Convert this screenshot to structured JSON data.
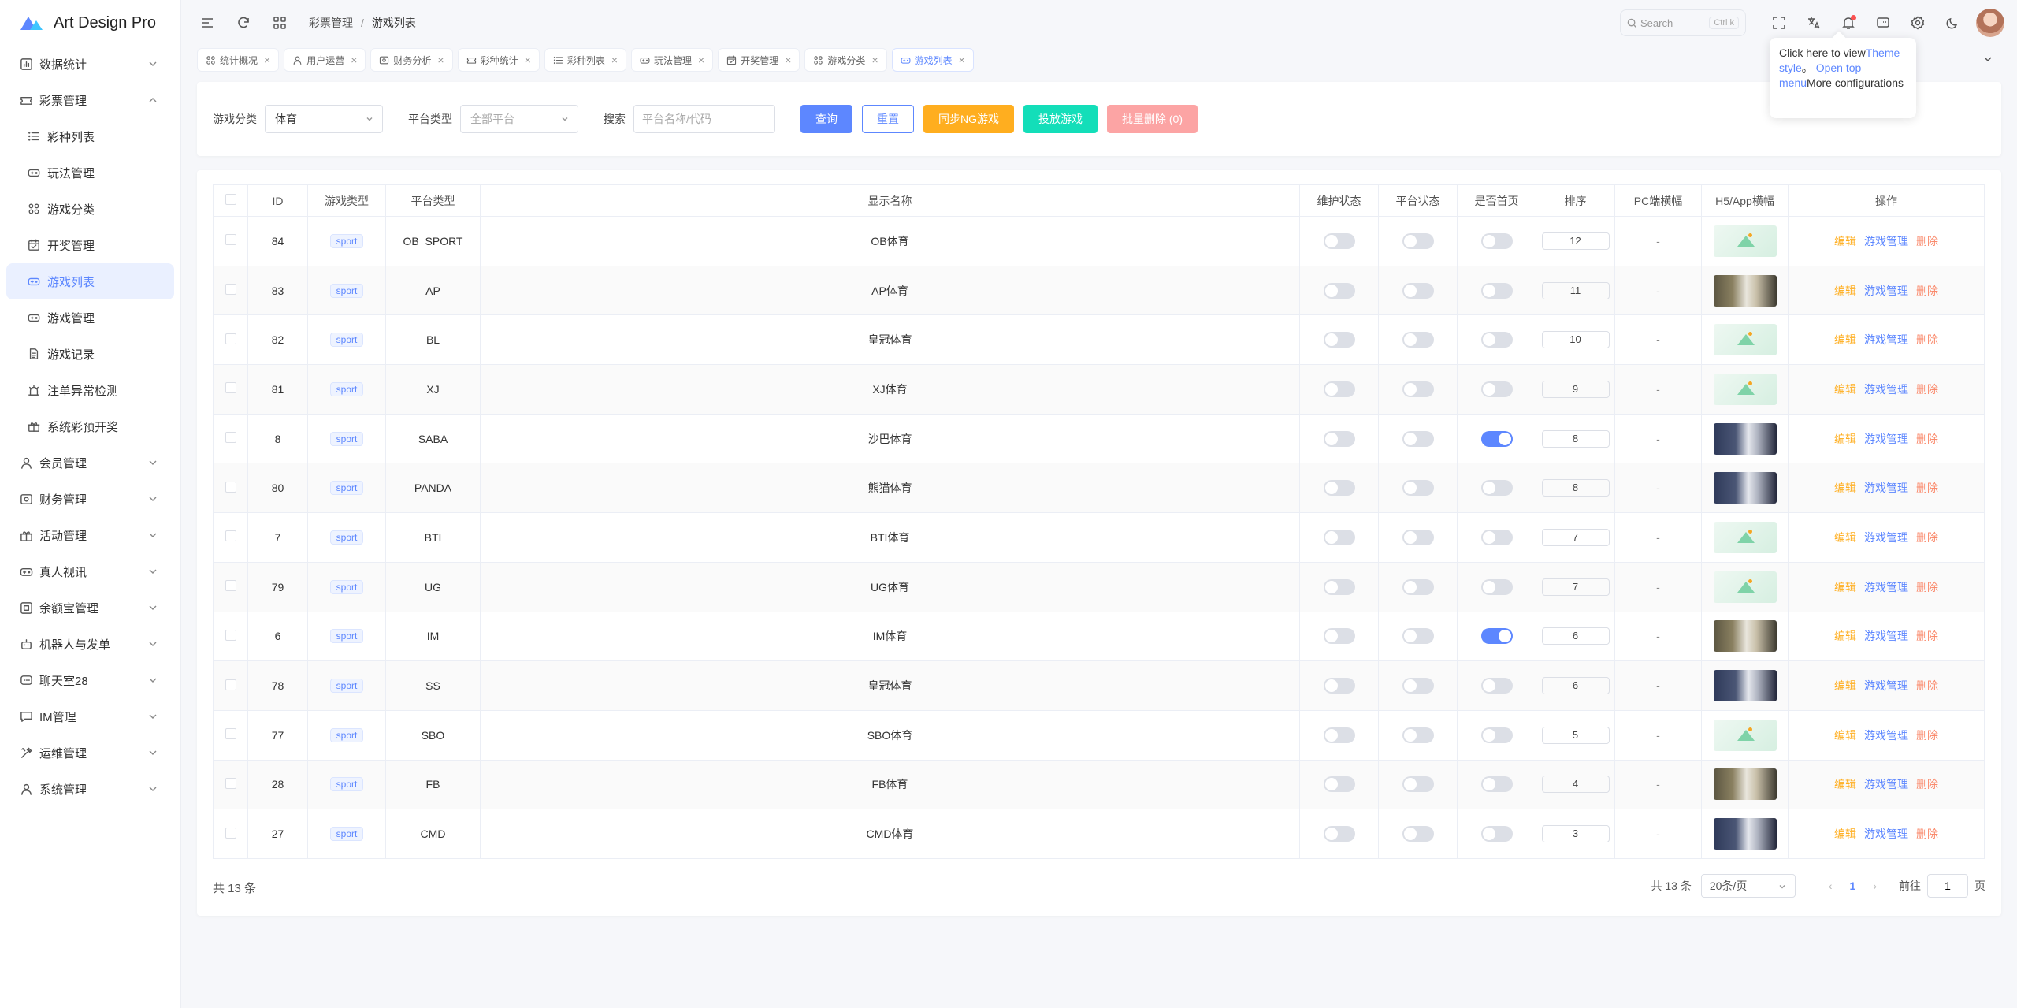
{
  "app": {
    "name": "Art Design Pro",
    "brand_color": "#5d87ff"
  },
  "sidebar": {
    "items": [
      {
        "label": "数据统计",
        "icon": "bar-chart-icon",
        "expanded": false
      },
      {
        "label": "彩票管理",
        "icon": "ticket-icon",
        "expanded": true
      },
      {
        "label": "会员管理",
        "icon": "user-icon",
        "expanded": false
      },
      {
        "label": "财务管理",
        "icon": "finance-icon",
        "expanded": false
      },
      {
        "label": "活动管理",
        "icon": "gift-icon",
        "expanded": false
      },
      {
        "label": "真人视讯",
        "icon": "gamepad-icon",
        "expanded": false
      },
      {
        "label": "余额宝管理",
        "icon": "wallet-icon",
        "expanded": false
      },
      {
        "label": "机器人与发单",
        "icon": "robot-icon",
        "expanded": false
      },
      {
        "label": "聊天室28",
        "icon": "chat-icon",
        "expanded": false
      },
      {
        "label": "IM管理",
        "icon": "message-icon",
        "expanded": false
      },
      {
        "label": "运维管理",
        "icon": "tools-icon",
        "expanded": false
      },
      {
        "label": "系统管理",
        "icon": "user-icon",
        "expanded": false
      }
    ],
    "sub_items": [
      {
        "label": "彩种列表",
        "icon": "list-icon"
      },
      {
        "label": "玩法管理",
        "icon": "gamepad-icon"
      },
      {
        "label": "游戏分类",
        "icon": "grid-icon"
      },
      {
        "label": "开奖管理",
        "icon": "calendar-icon"
      },
      {
        "label": "游戏列表",
        "icon": "gamepad-icon",
        "active": true
      },
      {
        "label": "游戏管理",
        "icon": "gamepad-icon"
      },
      {
        "label": "游戏记录",
        "icon": "document-icon"
      },
      {
        "label": "注单异常检测",
        "icon": "alarm-icon"
      },
      {
        "label": "系统彩预开奖",
        "icon": "gift-icon"
      }
    ]
  },
  "header": {
    "breadcrumb": [
      "彩票管理",
      "游戏列表"
    ],
    "search_placeholder": "Search",
    "search_shortcut": "Ctrl k"
  },
  "tabs": [
    {
      "label": "统计概况",
      "icon": "grid-icon"
    },
    {
      "label": "用户运营",
      "icon": "user-icon"
    },
    {
      "label": "财务分析",
      "icon": "finance-icon"
    },
    {
      "label": "彩种统计",
      "icon": "ticket-icon"
    },
    {
      "label": "彩种列表",
      "icon": "list-icon"
    },
    {
      "label": "玩法管理",
      "icon": "gamepad-icon"
    },
    {
      "label": "开奖管理",
      "icon": "calendar-icon"
    },
    {
      "label": "游戏分类",
      "icon": "grid-icon"
    },
    {
      "label": "游戏列表",
      "icon": "gamepad-icon",
      "active": true
    }
  ],
  "tooltip": {
    "text1": "Click here to view",
    "link1": "Theme style",
    "text2": "。 ",
    "link2": "Open top menu",
    "text3": "More configurations"
  },
  "filters": {
    "category_label": "游戏分类",
    "category_value": "体育",
    "platform_label": "平台类型",
    "platform_placeholder": "全部平台",
    "search_label": "搜索",
    "search_placeholder": "平台名称/代码",
    "btn_query": "查询",
    "btn_reset": "重置",
    "btn_sync": "同步NG游戏",
    "btn_launch": "投放游戏",
    "btn_batch_delete": "批量删除 (0)"
  },
  "table": {
    "columns": [
      "ID",
      "游戏类型",
      "平台类型",
      "显示名称",
      "维护状态",
      "平台状态",
      "是否首页",
      "排序",
      "PC端横幅",
      "H5/App横幅",
      "操作"
    ],
    "ops": {
      "edit": "编辑",
      "manage": "游戏管理",
      "delete": "删除"
    },
    "rows": [
      {
        "id": "84",
        "type": "sport",
        "platform": "OB_SPORT",
        "name": "OB体育",
        "maint": false,
        "plat": false,
        "home": false,
        "sort": "12",
        "pc": "-",
        "h5": "placeholder"
      },
      {
        "id": "83",
        "type": "sport",
        "platform": "AP",
        "name": "AP体育",
        "maint": false,
        "plat": false,
        "home": false,
        "sort": "11",
        "pc": "-",
        "h5": "photo"
      },
      {
        "id": "82",
        "type": "sport",
        "platform": "BL",
        "name": "皇冠体育",
        "maint": false,
        "plat": false,
        "home": false,
        "sort": "10",
        "pc": "-",
        "h5": "placeholder"
      },
      {
        "id": "81",
        "type": "sport",
        "platform": "XJ",
        "name": "XJ体育",
        "maint": false,
        "plat": false,
        "home": false,
        "sort": "9",
        "pc": "-",
        "h5": "placeholder"
      },
      {
        "id": "8",
        "type": "sport",
        "platform": "SABA",
        "name": "沙巴体育",
        "maint": false,
        "plat": false,
        "home": true,
        "sort": "8",
        "pc": "-",
        "h5": "photo2"
      },
      {
        "id": "80",
        "type": "sport",
        "platform": "PANDA",
        "name": "熊猫体育",
        "maint": false,
        "plat": false,
        "home": false,
        "sort": "8",
        "pc": "-",
        "h5": "photo2"
      },
      {
        "id": "7",
        "type": "sport",
        "platform": "BTI",
        "name": "BTI体育",
        "maint": false,
        "plat": false,
        "home": false,
        "sort": "7",
        "pc": "-",
        "h5": "placeholder"
      },
      {
        "id": "79",
        "type": "sport",
        "platform": "UG",
        "name": "UG体育",
        "maint": false,
        "plat": false,
        "home": false,
        "sort": "7",
        "pc": "-",
        "h5": "placeholder"
      },
      {
        "id": "6",
        "type": "sport",
        "platform": "IM",
        "name": "IM体育",
        "maint": false,
        "plat": false,
        "home": true,
        "sort": "6",
        "pc": "-",
        "h5": "photo"
      },
      {
        "id": "78",
        "type": "sport",
        "platform": "SS",
        "name": "皇冠体育",
        "maint": false,
        "plat": false,
        "home": false,
        "sort": "6",
        "pc": "-",
        "h5": "photo2"
      },
      {
        "id": "77",
        "type": "sport",
        "platform": "SBO",
        "name": "SBO体育",
        "maint": false,
        "plat": false,
        "home": false,
        "sort": "5",
        "pc": "-",
        "h5": "placeholder"
      },
      {
        "id": "28",
        "type": "sport",
        "platform": "FB",
        "name": "FB体育",
        "maint": false,
        "plat": false,
        "home": false,
        "sort": "4",
        "pc": "-",
        "h5": "photo"
      },
      {
        "id": "27",
        "type": "sport",
        "platform": "CMD",
        "name": "CMD体育",
        "maint": false,
        "plat": false,
        "home": false,
        "sort": "3",
        "pc": "-",
        "h5": "photo2"
      }
    ]
  },
  "pagination": {
    "total_left": "共 13 条",
    "total_right": "共 13 条",
    "page_size": "20条/页",
    "current_page": "1",
    "goto_label": "前往",
    "goto_value": "1",
    "page_suffix": "页"
  }
}
